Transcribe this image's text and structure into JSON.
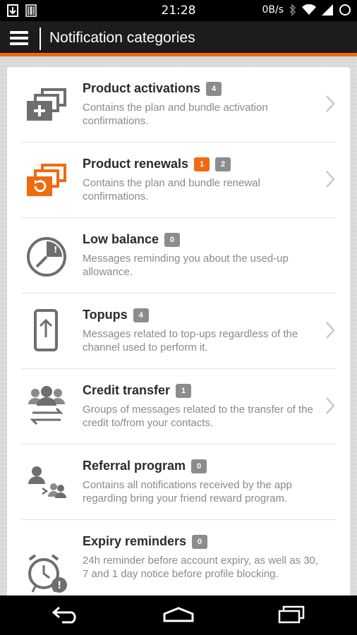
{
  "status_bar": {
    "time": "21:28",
    "network_speed": "0B/s"
  },
  "app_bar": {
    "title": "Notification categories"
  },
  "categories": [
    {
      "title": "Product activations",
      "badges": [
        {
          "count": "4",
          "color": "#8c8c8c"
        }
      ],
      "description": "Contains the plan and bundle activation confirmations.",
      "has_chevron": true,
      "icon": "cards-plus-icon"
    },
    {
      "title": "Product renewals",
      "badges": [
        {
          "count": "1",
          "color": "#f06a0f"
        },
        {
          "count": "2",
          "color": "#8c8c8c"
        }
      ],
      "description": "Contains the plan and bundle renewal confirmations.",
      "has_chevron": true,
      "icon": "cards-renew-icon"
    },
    {
      "title": "Low balance",
      "badges": [
        {
          "count": "0",
          "color": "#8c8c8c"
        }
      ],
      "description": "Messages reminding you about the used-up allowance.",
      "has_chevron": false,
      "icon": "clock-warning-icon"
    },
    {
      "title": "Topups",
      "badges": [
        {
          "count": "4",
          "color": "#8c8c8c"
        }
      ],
      "description": "Messages related to top-ups regardless of the channel used to perform it.",
      "has_chevron": true,
      "icon": "phone-upload-icon"
    },
    {
      "title": "Credit transfer",
      "badges": [
        {
          "count": "1",
          "color": "#8c8c8c"
        }
      ],
      "description": "Groups of messages related to the transfer of the credit to/from your contacts.",
      "has_chevron": true,
      "icon": "people-transfer-icon"
    },
    {
      "title": "Referral program",
      "badges": [
        {
          "count": "0",
          "color": "#8c8c8c"
        }
      ],
      "description": "Contains all notifications received by the app regarding bring your friend reward program.",
      "has_chevron": false,
      "icon": "referral-icon"
    },
    {
      "title": "Expiry reminders",
      "badges": [
        {
          "count": "0",
          "color": "#8c8c8c"
        }
      ],
      "description": "24h reminder before account expiry, as well as 30, 7 and 1 day notice before profile blocking.",
      "has_chevron": false,
      "icon": "alarm-warning-icon"
    }
  ],
  "colors": {
    "accent": "#f06a0f",
    "badge_gray": "#8c8c8c",
    "icon_gray": "#6e6e6e"
  }
}
